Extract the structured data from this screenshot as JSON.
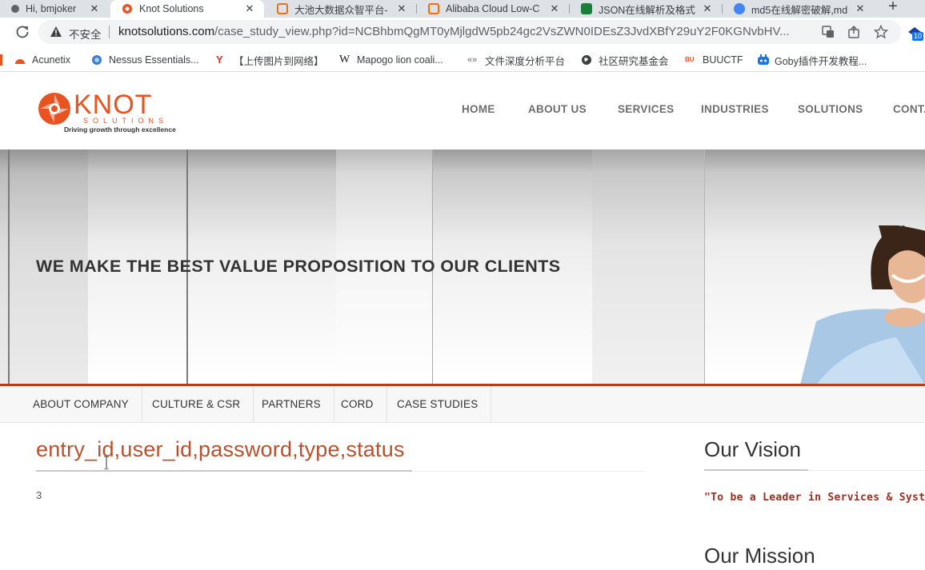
{
  "browser": {
    "tabs": [
      {
        "title": "Hi, bmjoker",
        "favicon_color": "#5f6368"
      },
      {
        "title": "Knot Solutions",
        "favicon_color": "#e8531f",
        "active": true
      },
      {
        "title": "大池大数据众智平台-",
        "favicon_color": "#e8711f"
      },
      {
        "title": "Alibaba Cloud Low-C",
        "favicon_color": "#ff6a00"
      },
      {
        "title": "JSON在线解析及格式",
        "favicon_color": "#188038"
      },
      {
        "title": "md5在线解密破解,md",
        "favicon_color": "#4285f4"
      }
    ],
    "tab_close_glyph": "✕",
    "new_tab_glyph": "+",
    "security_label": "不安全",
    "url_host": "knotsolutions.com",
    "url_path": "/case_study_view.php?id=NCBhbmQgMT0yMjlgdW5pb24gc2VsZWN0IDEsZ3JvdXBfY29uY2F0KGNvbHV...",
    "extension_badge": "10",
    "bookmarks": [
      {
        "label": "Acunetix",
        "icon": "acunetix-icon",
        "color": "#e8531f"
      },
      {
        "label": "Nessus Essentials...",
        "icon": "nessus-icon",
        "color": "#3a7bd5"
      },
      {
        "label": "【上传图片到网络】",
        "icon": "yahoo-y-icon",
        "color": "#d93025"
      },
      {
        "label": "Mapogo lion coali...",
        "icon": "wikipedia-w-icon",
        "color": "#202124"
      },
      {
        "label": "文件深度分析平台",
        "icon": "analysis-icon",
        "color": "#5f6368"
      },
      {
        "label": "社区研究基金会",
        "icon": "globe-icon",
        "color": "#3c4043"
      },
      {
        "label": "BUUCTF",
        "icon": "buuctf-icon",
        "color": "#e8531f"
      },
      {
        "label": "Goby插件开发教程...",
        "icon": "goby-icon",
        "color": "#1a73e8"
      }
    ]
  },
  "site": {
    "logo_text": "KNOT",
    "logo_sub": "SOLUTIONS",
    "logo_tagline": "Driving growth through excellence",
    "brand_color": "#e8531f",
    "nav": [
      "HOME",
      "ABOUT US",
      "SERVICES",
      "INDUSTRIES",
      "SOLUTIONS",
      "CONT..."
    ],
    "hero_title": "WE MAKE THE BEST VALUE PROPOSITION TO OUR CLIENTS",
    "subnav": [
      "ABOUT COMPANY",
      "CULTURE & CSR",
      "PARTNERS",
      "CORD",
      "CASE STUDIES"
    ],
    "main_heading": "entry_id,user_id,password,type,status",
    "main_value": "3",
    "vision_title": "Our Vision",
    "vision_quote": "\"To be a Leader in Services & System In",
    "mission_title": "Our Mission",
    "accent_color": "#b8512e"
  }
}
